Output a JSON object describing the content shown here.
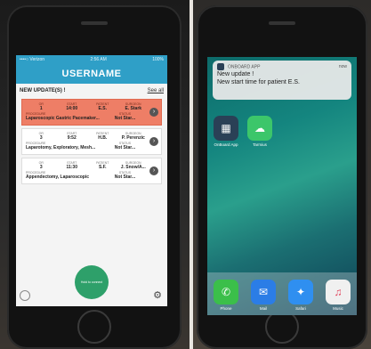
{
  "left": {
    "status": {
      "carrier": "••••○ Verizon",
      "time": "2:56 AM",
      "battery": "100%"
    },
    "app_title": "USERNAME",
    "updates_label": "NEW UPDATE(S) !",
    "see_all": "See all",
    "cards": [
      {
        "highlight": true,
        "row1": [
          {
            "label": "OR",
            "value": "1"
          },
          {
            "label": "START",
            "value": "14:00"
          },
          {
            "label": "PATIENT",
            "value": "E.S."
          },
          {
            "label": "SURGEON",
            "value": "E. Stark"
          }
        ],
        "row2": [
          {
            "label": "PROCEDURE",
            "value": "Laparoscopic Gastric Pacemaker..."
          },
          {
            "label": "STATUS",
            "value": "Not Star..."
          }
        ]
      },
      {
        "highlight": false,
        "row1": [
          {
            "label": "OR",
            "value": "3"
          },
          {
            "label": "START",
            "value": "9:52"
          },
          {
            "label": "PATIENT",
            "value": "H.B."
          },
          {
            "label": "SURGEON",
            "value": "P. Perenzic"
          }
        ],
        "row2": [
          {
            "label": "PROCEDURE",
            "value": "Laparotomy, Exploratory, Mesh..."
          },
          {
            "label": "STATUS",
            "value": "Not Star..."
          }
        ]
      },
      {
        "highlight": false,
        "row1": [
          {
            "label": "OR",
            "value": "3"
          },
          {
            "label": "START",
            "value": "11:30"
          },
          {
            "label": "PATIENT",
            "value": "S.F."
          },
          {
            "label": "SURGEON",
            "value": "J. Snow/A..."
          }
        ],
        "row2": [
          {
            "label": "PROCEDURE",
            "value": "Appendectomy, Laparoscopic"
          },
          {
            "label": "STATUS",
            "value": "Not Star..."
          }
        ]
      }
    ],
    "fab_label": "Hold to connect"
  },
  "right": {
    "notification": {
      "app_name": "ONBOARD APP",
      "time": "now",
      "line1": "New update !",
      "line2": "New start time for patient E.S."
    },
    "home_apps": [
      {
        "label": "OnBoard App",
        "color": "#2a4056",
        "icon": "tower-icon"
      },
      {
        "label": "Tarmius",
        "color": "#3cc66a",
        "icon": "chat-icon"
      }
    ],
    "dock": [
      {
        "label": "Phone",
        "color": "#3bbf4a",
        "icon": "phone-icon"
      },
      {
        "label": "Mail",
        "color": "#2b7de6",
        "icon": "mail-icon"
      },
      {
        "label": "Safari",
        "color": "#2f8ff0",
        "icon": "compass-icon"
      },
      {
        "label": "Music",
        "color": "#f0f0f0",
        "icon": "music-icon"
      }
    ]
  }
}
